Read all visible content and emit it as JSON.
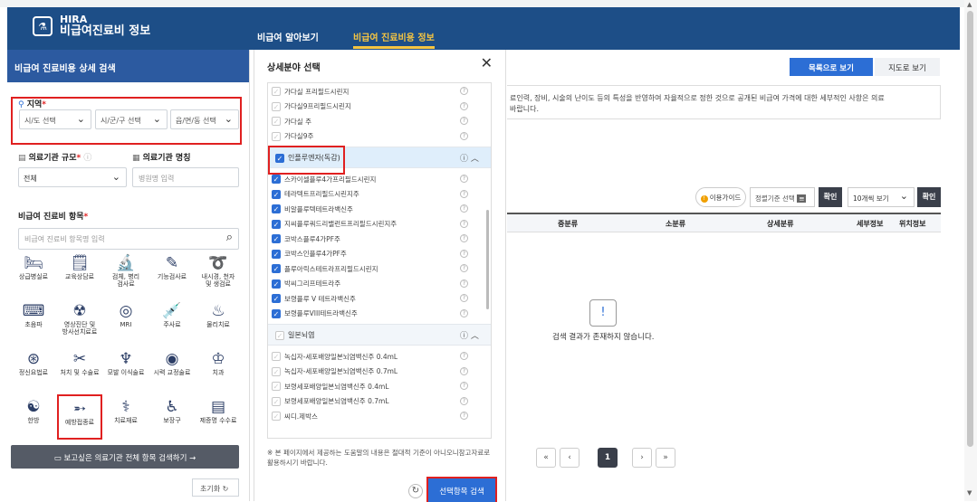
{
  "header": {
    "logo_top": "HIRA",
    "logo_bottom": "비급여진료비 정보",
    "nav": [
      "비급여 알아보기",
      "비급여 진료비용 정보"
    ]
  },
  "left": {
    "title": "비급여 진료비용 상세 검색",
    "region_label": "지역",
    "region_selects": [
      "시/도 선택",
      "시/군/구 선택",
      "읍/면/동 선택"
    ],
    "scale_label": "의료기관 규모",
    "scale_value": "전체",
    "name_label": "의료기관 명칭",
    "name_placeholder": "병원명 입력",
    "items_label": "비급여 진료비 항목",
    "items_placeholder": "비급여 진료비 항목명 입력",
    "categories": [
      {
        "icon": "🛏",
        "label": "상급병실료"
      },
      {
        "icon": "🗒",
        "label": "교육상담료"
      },
      {
        "icon": "🔬",
        "label": "검체, 병리\n검사료"
      },
      {
        "icon": "✎",
        "label": "기능검사료"
      },
      {
        "icon": "➰",
        "label": "내시경, 천자\n및 생검료"
      },
      {
        "icon": "⌨",
        "label": "초음파"
      },
      {
        "icon": "☢",
        "label": "영상진단 및\n방사선치료료"
      },
      {
        "icon": "◎",
        "label": "MRI"
      },
      {
        "icon": "💉",
        "label": "주사료"
      },
      {
        "icon": "♨",
        "label": "물리치료"
      },
      {
        "icon": "⊛",
        "label": "정신요법료"
      },
      {
        "icon": "✂",
        "label": "처치 및 수술료"
      },
      {
        "icon": "♆",
        "label": "모발 이식술료"
      },
      {
        "icon": "◉",
        "label": "시력 교정술료"
      },
      {
        "icon": "♔",
        "label": "치과"
      },
      {
        "icon": "☯",
        "label": "한방"
      },
      {
        "icon": "➵",
        "label": "예방접종료"
      },
      {
        "icon": "⚕",
        "label": "치료재료"
      },
      {
        "icon": "♿",
        "label": "보장구"
      },
      {
        "icon": "▤",
        "label": "제증명 수수료"
      }
    ],
    "search_all": "보고싶은 의료기관 전체 항목 검색하기  →",
    "reset": "초기화"
  },
  "modal": {
    "title": "상세분야 선택",
    "top_items": [
      "가다실 프리필드시린지",
      "가다실9프리필드시린지",
      "가다실 주",
      "가다실9주"
    ],
    "group1": "인플루엔자(독감)",
    "group1_items": [
      "스카이셀플루4가프리필드시린지",
      "테라텍트프리필드시린지주",
      "비알플루텍테트라백신주",
      "지씨플루쿼드리밸런트프리필드시린지주",
      "코박스플루4가PF주",
      "코박스인플루4가PF주",
      "플루아릭스테트라프리필드시린지",
      "박씨그리프테트라주",
      "보령플루 V 테트라백신주",
      "보령플루VIII테트라백신주"
    ],
    "group2": "일본뇌염",
    "group2_items": [
      "녹십자-세포배양일본뇌염백신주 0.4mL",
      "녹십자-세포배양일본뇌염백신주 0.7mL",
      "보령세포배양일본뇌염백신주 0.4mL",
      "보령세포배양일본뇌염백신주 0.7mL",
      "씨디.제박스"
    ],
    "note": "※ 본 페이지에서 제공하는 도움말의 내용은 절대적 기준이 아니오니참고자료로 활용하시기 바랍니다.",
    "apply": "선택항목 검색"
  },
  "main": {
    "list_view": "목록으로 보기",
    "map_view": "지도로 보기",
    "info": "료인력, 장비, 시술의 난이도 등의 특성을 반영하여 자율적으로 정한 것으로 공개된 비급여 가격에 대한 세부적인 사항은 의료\n바랍니다.",
    "guide": "이용가이드",
    "sort": "정렬기준 선택",
    "ok": "확인",
    "page_size": "10개씩 보기",
    "columns": [
      "중분류",
      "소분류",
      "상세분류",
      "세부정보",
      "위치정보"
    ],
    "empty": "검색 결과가 존재하지 않습니다.",
    "current_page": "1"
  }
}
